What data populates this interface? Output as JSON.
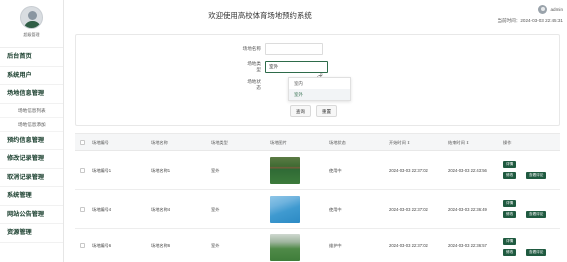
{
  "app": {
    "title": "欢迎使用高校体育场地预约系统",
    "profile_name": "超级管理",
    "user": "admin",
    "time_label": "当前时间：2024-03-03 22:45:31"
  },
  "colors": {
    "accent": "#1f5a40",
    "menu_text": "#1a3f2e"
  },
  "sidebar": {
    "items": [
      {
        "label": "后台首页"
      },
      {
        "label": "系统用户"
      },
      {
        "label": "场地信息管理"
      },
      {
        "label": "场地信息列表"
      },
      {
        "label": "场地信息添加"
      },
      {
        "label": "预约信息管理"
      },
      {
        "label": "修改记录管理"
      },
      {
        "label": "取消记录管理"
      },
      {
        "label": "系统管理"
      },
      {
        "label": "网站公告管理"
      },
      {
        "label": "资源管理"
      }
    ]
  },
  "search": {
    "name_label": "场地名称",
    "name_value": "",
    "type_label": "场地类型",
    "type_value": "室外",
    "status_label": "场地状态",
    "dropdown_options": [
      "室内",
      "室外"
    ],
    "query_label": "查询",
    "reset_label": "重置"
  },
  "table": {
    "headers": [
      "场地编号",
      "场地名称",
      "场地类型",
      "场地图片",
      "场地状态",
      "开始时间 ⇕",
      "结束时间 ⇕",
      "操作"
    ],
    "rows": [
      {
        "code": "场地编号1",
        "name": "场地名称1",
        "type": "室外",
        "status": "使用中",
        "start": "2024-03-03 22:37:02",
        "end": "2024-03-03 22:43:56"
      },
      {
        "code": "场地编号4",
        "name": "场地名称4",
        "type": "室外",
        "status": "使用中",
        "start": "2024-03-03 22:37:02",
        "end": "2024-03-03 22:36:49"
      },
      {
        "code": "场地编号6",
        "name": "场地名称6",
        "type": "室外",
        "status": "维护中",
        "start": "2024-03-03 22:37:02",
        "end": "2024-03-03 22:36:57"
      }
    ],
    "actions": {
      "detail": "详情",
      "edit": "修改",
      "review": "查看评论"
    }
  }
}
